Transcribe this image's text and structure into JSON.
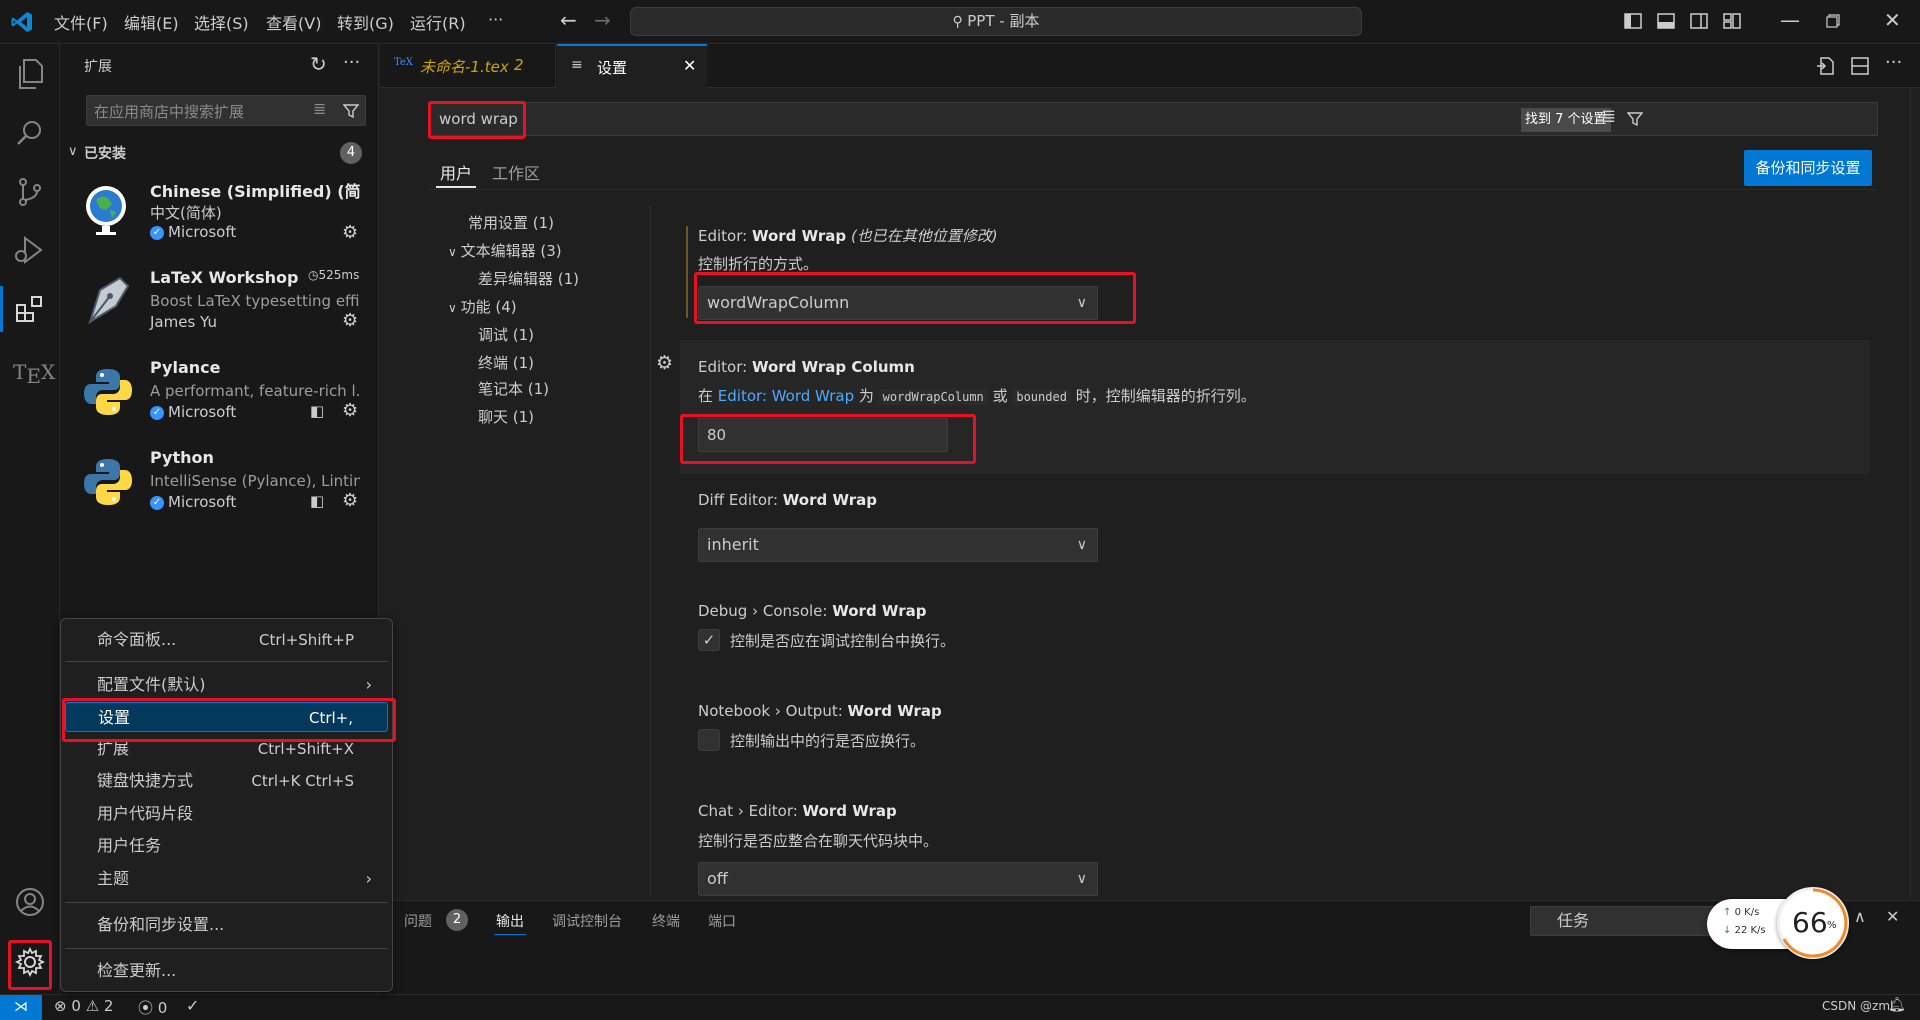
{
  "titlebar": {
    "menus": [
      "文件(F)",
      "编辑(E)",
      "选择(S)",
      "查看(V)",
      "转到(G)",
      "运行(R)",
      "···"
    ],
    "search_text": "PPT - 副本"
  },
  "sidebar": {
    "title": "扩展",
    "search_placeholder": "在应用商店中搜索扩展",
    "installed_label": "已安装",
    "installed_count": "4",
    "extensions": [
      {
        "name": "Chinese (Simplified) (简体...",
        "desc": "中文(简体)",
        "publisher": "Microsoft"
      },
      {
        "name": "LaTeX Workshop",
        "timing": "525ms",
        "desc": "Boost LaTeX typesetting effi...",
        "publisher": "James Yu"
      },
      {
        "name": "Pylance",
        "desc": "A performant, feature-rich l...",
        "publisher": "Microsoft"
      },
      {
        "name": "Python",
        "desc": "IntelliSense (Pylance), Lintin...",
        "publisher": "Microsoft"
      }
    ]
  },
  "tabs": [
    {
      "label": "未命名-1.tex",
      "badge": "2",
      "icon": "TeX"
    },
    {
      "label": "设置"
    }
  ],
  "settings": {
    "search_value": "word wrap",
    "found_label": "找到 7 个设置",
    "scope_tabs": [
      "用户",
      "工作区"
    ],
    "backup_button": "备份和同步设置",
    "toc": [
      {
        "label": "常用设置 (1)"
      },
      {
        "label": "文本编辑器 (3)"
      },
      {
        "label": "差异编辑器 (1)"
      },
      {
        "label": "功能 (4)"
      },
      {
        "label": "调试 (1)"
      },
      {
        "label": "终端 (1)"
      },
      {
        "label": "笔记本 (1)"
      },
      {
        "label": "聊天 (1)"
      }
    ],
    "items": [
      {
        "prefix": "Editor: ",
        "name": "Word Wrap",
        "modified": "(也已在其他位置修改)",
        "desc": "控制折行的方式。",
        "value": "wordWrapColumn"
      },
      {
        "prefix": "Editor: ",
        "name": "Word Wrap Column",
        "desc_pre": "在 ",
        "desc_link": "Editor: Word Wrap",
        "desc_mid": " 为 ",
        "code1": "wordWrapColumn",
        "desc_or": " 或 ",
        "code2": "bounded",
        "desc_post": " 时，控制编辑器的折行列。",
        "value": "80"
      },
      {
        "prefix": "Diff Editor: ",
        "name": "Word Wrap",
        "value": "inherit"
      },
      {
        "prefix": "Debug › Console: ",
        "name": "Word Wrap",
        "desc": "控制是否应在调试控制台中换行。",
        "checked": true
      },
      {
        "prefix": "Notebook › Output: ",
        "name": "Word Wrap",
        "desc": "控制输出中的行是否应换行。",
        "checked": false
      },
      {
        "prefix": "Chat › Editor: ",
        "name": "Word Wrap",
        "desc": "控制行是否应整合在聊天代码块中。",
        "value": "off"
      }
    ]
  },
  "panel": {
    "tabs": [
      "问题",
      "输出",
      "调试控制台",
      "终端",
      "端口"
    ],
    "problems_count": "2",
    "task_select": "任务"
  },
  "netwidget": {
    "up": "0",
    "down": "22",
    "unit": "K/s",
    "percent": "66",
    "percent_sign": "%"
  },
  "context_menu": {
    "items": [
      {
        "label": "命令面板...",
        "shortcut": "Ctrl+Shift+P"
      },
      {
        "label": "配置文件(默认)",
        "submenu": true
      },
      {
        "label": "设置",
        "shortcut": "Ctrl+,"
      },
      {
        "label": "扩展",
        "shortcut": "Ctrl+Shift+X"
      },
      {
        "label": "键盘快捷方式",
        "shortcut": "Ctrl+K Ctrl+S"
      },
      {
        "label": "用户代码片段"
      },
      {
        "label": "用户任务"
      },
      {
        "label": "主题",
        "submenu": true
      },
      {
        "label": "备份和同步设置..."
      },
      {
        "label": "检查更新..."
      }
    ]
  },
  "statusbar": {
    "errors": "0",
    "warnings": "2",
    "ports": "0",
    "watermark": "CSDN @zml"
  },
  "colors": {
    "accent": "#0078d4",
    "highlight_red": "#e81123",
    "link": "#4daafc"
  }
}
